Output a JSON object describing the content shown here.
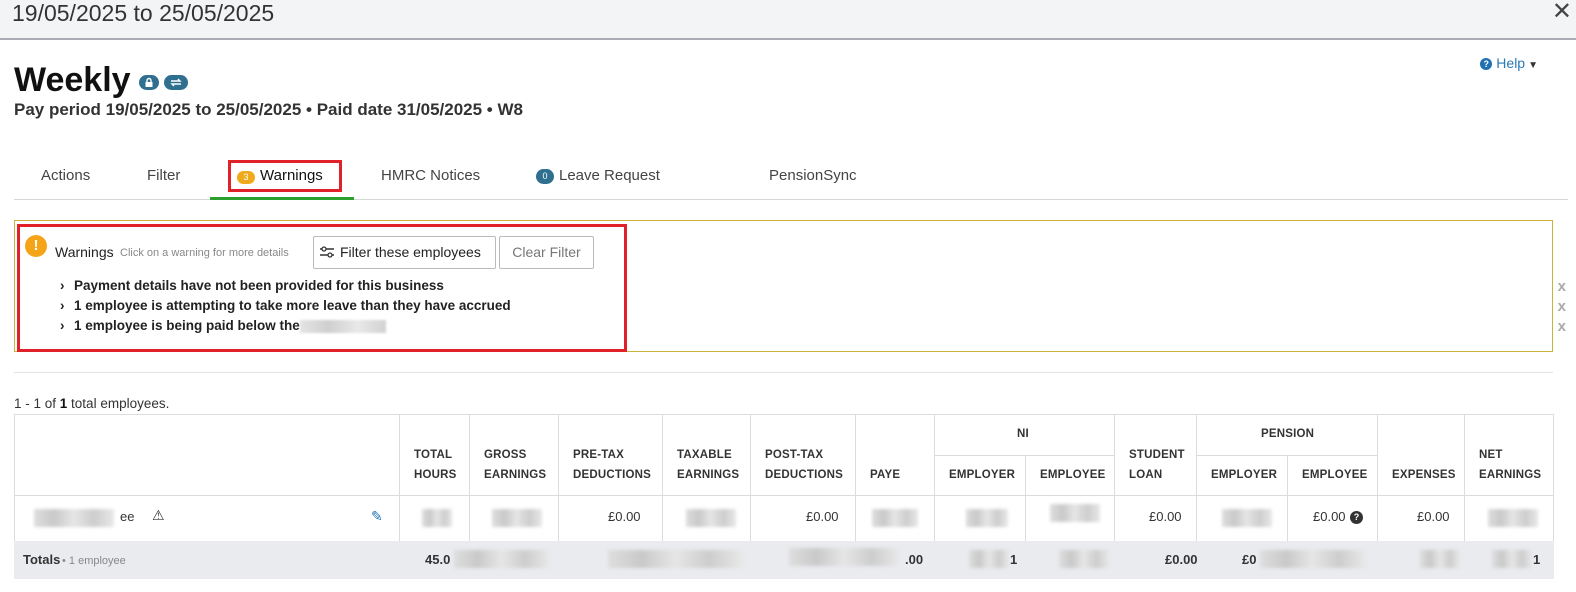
{
  "window": {
    "title": "19/05/2025 to 25/05/2025",
    "close": "✕"
  },
  "header": {
    "title": "Weekly",
    "subtitle": "Pay period 19/05/2025 to 25/05/2025 • Paid date 31/05/2025 • W8",
    "help": "Help"
  },
  "tabs": {
    "actions": "Actions",
    "filter": "Filter",
    "warnings": {
      "label": "Warnings",
      "count": "3"
    },
    "hmrc": "HMRC Notices",
    "leave": {
      "label": "Leave Request",
      "count": "0"
    },
    "pension": "PensionSync"
  },
  "warnings": {
    "heading": "Warnings",
    "hint": "Click on a warning for more details",
    "filter_button": "Filter these employees",
    "clear_button": "Clear Filter",
    "items": [
      "Payment details have not been provided for this business",
      "1 employee is attempting to take more leave than they have accrued",
      "1 employee is being paid below the"
    ],
    "dismiss": "x"
  },
  "summary": {
    "prefix": "1 - 1 of ",
    "total": "1",
    "suffix": " total employees."
  },
  "table": {
    "headers": {
      "total_hours": [
        "TOTAL",
        "HOURS"
      ],
      "gross": [
        "GROSS",
        "EARNINGS"
      ],
      "pretax": [
        "PRE-TAX",
        "DEDUCTIONS"
      ],
      "taxable": [
        "TAXABLE",
        "EARNINGS"
      ],
      "posttax": [
        "POST-TAX",
        "DEDUCTIONS"
      ],
      "paye": "PAYE",
      "ni": "NI",
      "ni_employer": "EMPLOYER",
      "ni_employee": "EMPLOYEE",
      "student_loan": [
        "STUDENT",
        "LOAN"
      ],
      "pension": "PENSION",
      "pension_employer": "EMPLOYER",
      "pension_employee": "EMPLOYEE",
      "expenses": "EXPENSES",
      "net": [
        "NET",
        "EARNINGS"
      ]
    },
    "row": {
      "name_suffix": "ee",
      "pretax": "£0.00",
      "posttax": "£0.00",
      "student_loan": "£0.00",
      "pension_employee": "£0.00",
      "expenses": "£0.00"
    },
    "totals": {
      "label": "Totals",
      "count": "• 1 employee",
      "total_hours": "45.0",
      "paye": ".00",
      "ni_employer": "1",
      "student_loan": "£0.00",
      "pension_employer": "£0",
      "net": "1"
    }
  }
}
